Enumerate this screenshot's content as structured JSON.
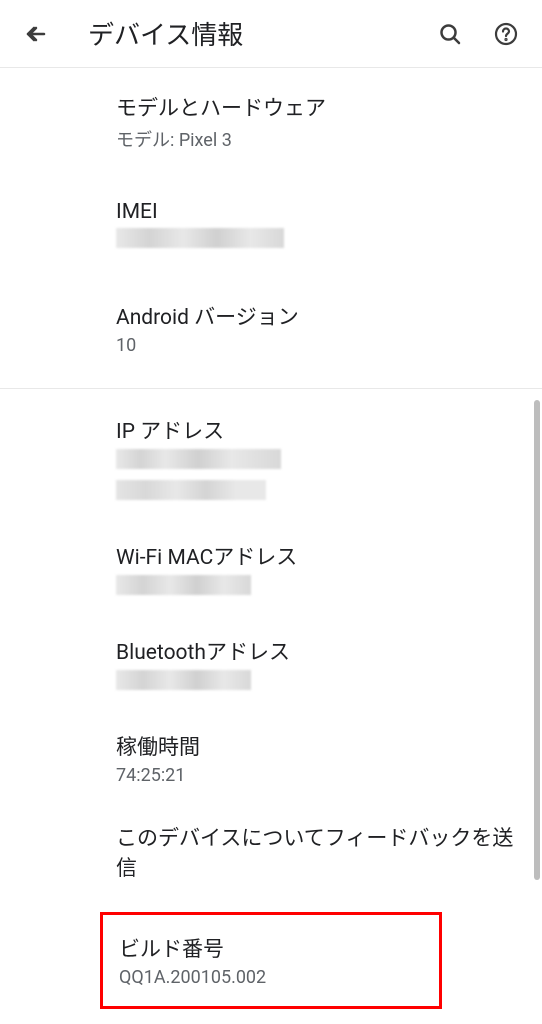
{
  "header": {
    "title": "デバイス情報"
  },
  "items": {
    "model": {
      "title": "モデルとハードウェア",
      "subtitle": "モデル: Pixel 3"
    },
    "imei": {
      "title": "IMEI"
    },
    "android_version": {
      "title": "Android バージョン",
      "subtitle": "10"
    },
    "ip_address": {
      "title": "IP アドレス"
    },
    "wifi_mac": {
      "title": "Wi-Fi MACアドレス"
    },
    "bluetooth": {
      "title": "Bluetoothアドレス"
    },
    "uptime": {
      "title": "稼働時間",
      "subtitle": "74:25:21"
    },
    "feedback": {
      "title": "このデバイスについてフィードバックを送信"
    },
    "build": {
      "title": "ビルド番号",
      "subtitle": "QQ1A.200105.002"
    }
  }
}
